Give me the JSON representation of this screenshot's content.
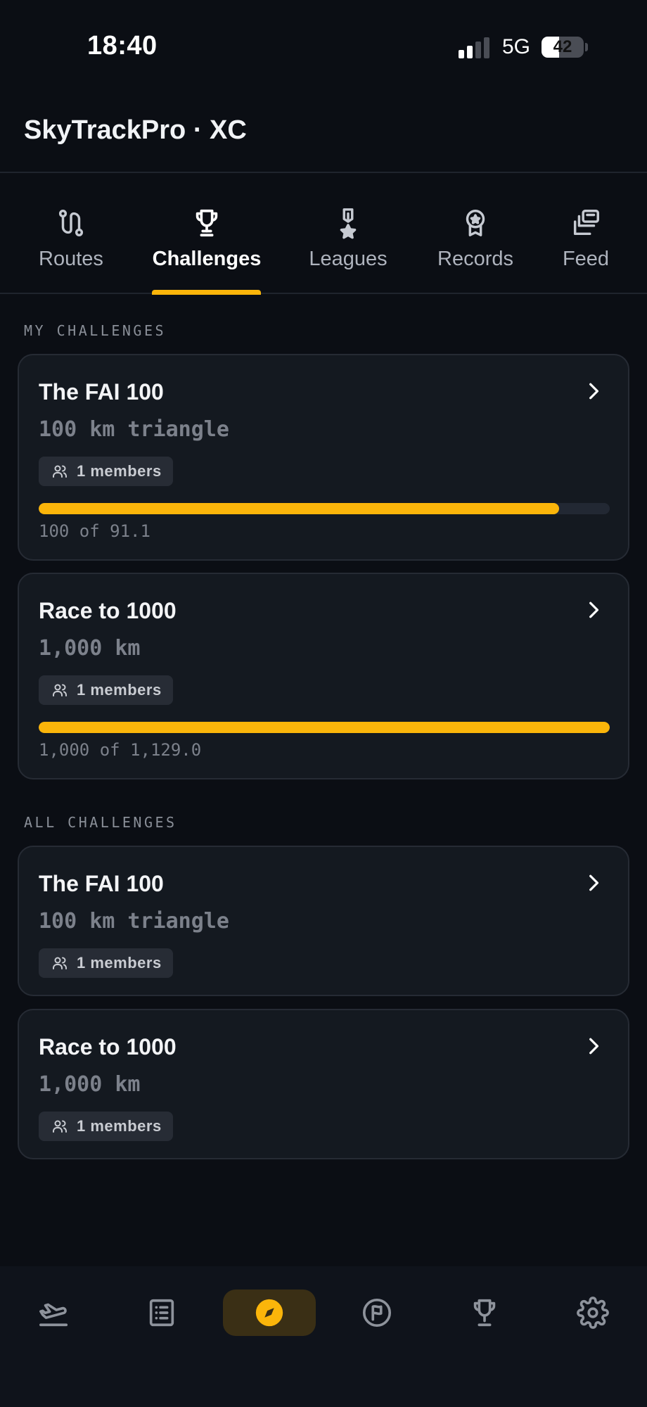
{
  "status_bar": {
    "time": "18:40",
    "network": "5G",
    "battery": "42",
    "battery_level": 0.42
  },
  "header": {
    "title": "SkyTrackPro · XC"
  },
  "tabs": [
    {
      "label": "Routes",
      "icon": "route-icon",
      "active": false
    },
    {
      "label": "Challenges",
      "icon": "trophy-icon",
      "active": true
    },
    {
      "label": "Leagues",
      "icon": "medal-icon",
      "active": false
    },
    {
      "label": "Records",
      "icon": "award-icon",
      "active": false
    },
    {
      "label": "Feed",
      "icon": "feed-icon",
      "active": false
    }
  ],
  "my_challenges": {
    "heading": "MY CHALLENGES",
    "items": [
      {
        "title": "The FAI 100",
        "subtitle": "100 km triangle",
        "members": "1 members",
        "progress_text": "100 of 91.1",
        "progress_fraction": 0.911
      },
      {
        "title": "Race to 1000",
        "subtitle": "1,000 km",
        "members": "1 members",
        "progress_text": "1,000 of 1,129.0",
        "progress_fraction": 1.0
      }
    ]
  },
  "all_challenges": {
    "heading": "ALL CHALLENGES",
    "items": [
      {
        "title": "The FAI 100",
        "subtitle": "100 km triangle",
        "members": "1 members"
      },
      {
        "title": "Race to 1000",
        "subtitle": "1,000 km",
        "members": "1 members"
      }
    ]
  },
  "bottom_nav": [
    {
      "icon": "takeoff-icon",
      "active": false
    },
    {
      "icon": "logbook-icon",
      "active": false
    },
    {
      "icon": "compass-icon",
      "active": true
    },
    {
      "icon": "flag-icon",
      "active": false
    },
    {
      "icon": "trophy-icon",
      "active": false
    },
    {
      "icon": "settings-icon",
      "active": false
    }
  ],
  "colors": {
    "accent": "#fbb50a",
    "background": "#0b0e14",
    "card": "#141920",
    "muted": "#7c818b"
  }
}
